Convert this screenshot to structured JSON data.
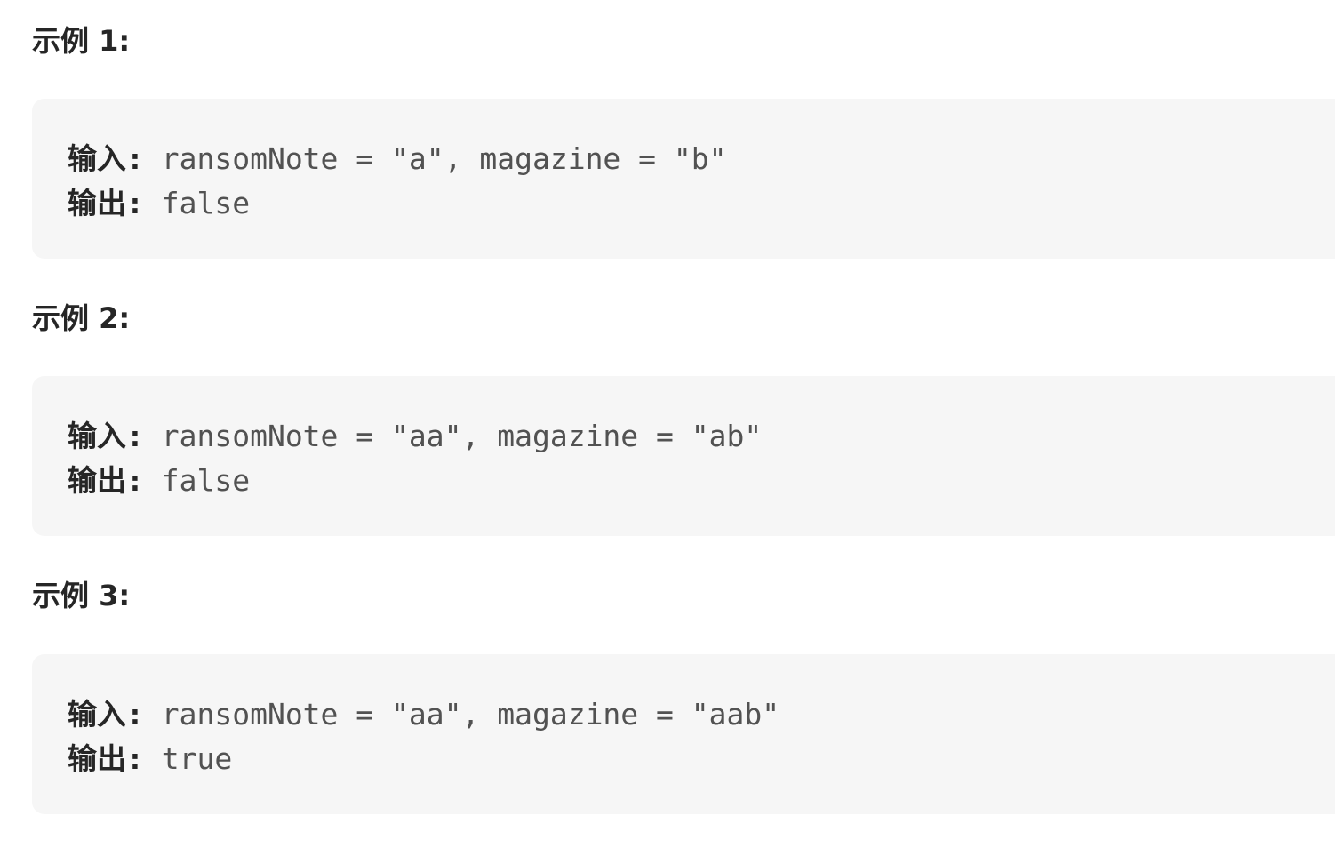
{
  "examples": [
    {
      "heading": "示例 1:",
      "input_label": "输入",
      "colon": ":",
      "input_value": " ransomNote = \"a\", magazine = \"b\"",
      "output_label": "输出",
      "output_value": " false"
    },
    {
      "heading": "示例 2:",
      "input_label": "输入",
      "colon": ":",
      "input_value": " ransomNote = \"aa\", magazine = \"ab\"",
      "output_label": "输出",
      "output_value": " false"
    },
    {
      "heading": "示例 3:",
      "input_label": "输入",
      "colon": ":",
      "input_value": " ransomNote = \"aa\", magazine = \"aab\"",
      "output_label": "输出",
      "output_value": " true"
    }
  ]
}
